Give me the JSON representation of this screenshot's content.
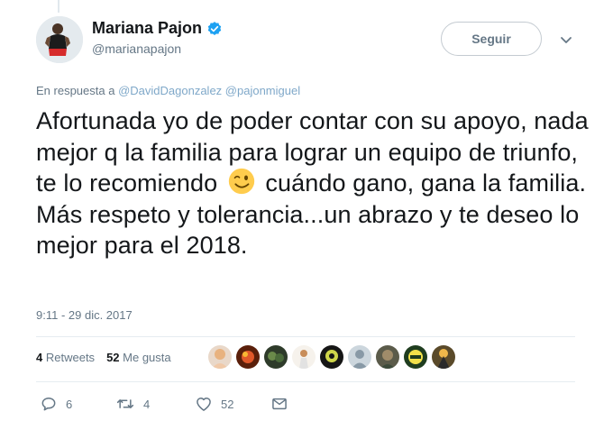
{
  "author": {
    "display_name": "Mariana Pajon",
    "handle": "@marianapajon",
    "verified": true
  },
  "follow_button_label": "Seguir",
  "reply_context": {
    "prefix": "En respuesta a",
    "mentions": [
      "@DavidDagonzalez",
      "@pajonmiguel"
    ]
  },
  "tweet": {
    "text_before_emoji": "Afortunada yo de poder contar con su apoyo, nada mejor q la familia para lograr un equipo de triunfo, te lo recomiendo",
    "emoji": "winking-face",
    "text_after_emoji": "cuándo gano, gana la familia. Más respeto y tolerancia...un abrazo y te deseo lo mejor para el 2018.",
    "timestamp": "9:11 - 29 dic. 2017"
  },
  "stats": {
    "retweets_count": "4",
    "retweets_label": "Retweets",
    "likes_count": "52",
    "likes_label": "Me gusta"
  },
  "actions": {
    "reply_count": "6",
    "retweet_count": "4",
    "like_count": "52"
  },
  "colors": {
    "text": "#14171a",
    "secondary": "#657786",
    "mention": "#7fa8c9",
    "verified": "#1da1f2",
    "border": "#e6ecf0"
  }
}
